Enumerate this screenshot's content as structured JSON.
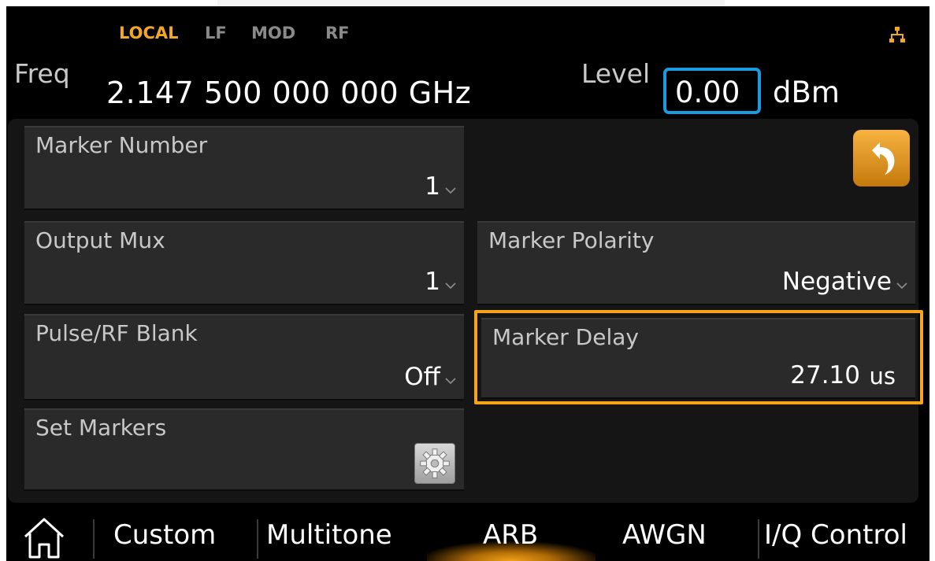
{
  "status": {
    "local": "LOCAL",
    "lf": "LF",
    "mod": "MOD",
    "rf": "RF"
  },
  "freq": {
    "label": "Freq",
    "value": "2.147 500 000 000  GHz"
  },
  "level": {
    "label": "Level",
    "value": "0.00",
    "unit": "dBm"
  },
  "fields": {
    "marker_number": {
      "label": "Marker Number",
      "value": "1"
    },
    "output_mux": {
      "label": "Output Mux",
      "value": "1"
    },
    "pulse_rf_blank": {
      "label": "Pulse/RF Blank",
      "value": "Off"
    },
    "set_markers": {
      "label": "Set Markers"
    },
    "marker_polarity": {
      "label": "Marker Polarity",
      "value": "Negative"
    },
    "marker_delay": {
      "label": "Marker Delay",
      "value": "27.10",
      "unit": "us"
    }
  },
  "tabs": {
    "custom": "Custom",
    "multitone": "Multitone",
    "arb": "ARB",
    "awgn": "AWGN",
    "iq_control": "I/Q Control"
  },
  "colors": {
    "accent": "#f5a515",
    "level_box": "#1a9be0",
    "local": "#f2a826"
  },
  "icons": [
    "network-icon",
    "back-arrow-icon",
    "gear-icon",
    "chevron-down-icon",
    "home-icon"
  ]
}
